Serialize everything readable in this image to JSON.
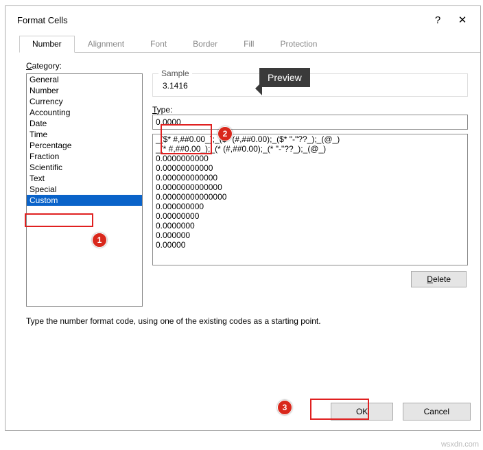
{
  "title": "Format Cells",
  "tabs": [
    "Number",
    "Alignment",
    "Font",
    "Border",
    "Fill",
    "Protection"
  ],
  "active_tab": 0,
  "category_label": "Category:",
  "categories": [
    "General",
    "Number",
    "Currency",
    "Accounting",
    "Date",
    "Time",
    "Percentage",
    "Fraction",
    "Scientific",
    "Text",
    "Special",
    "Custom"
  ],
  "selected_category_index": 11,
  "sample": {
    "legend": "Sample",
    "value": "3.1416"
  },
  "type_label": "Type:",
  "type_value": "0.0000",
  "format_codes": [
    "_($* #,##0.00_);_($* (#,##0.00);_($* \"-\"??_);_(@_)",
    "_(* #,##0.00_);_(* (#,##0.00);_(* \"-\"??_);_(@_)",
    "0.0000000000",
    "0.00000000000",
    "0.000000000000",
    "0.0000000000000",
    "0.00000000000000",
    "0.000000000",
    "0.00000000",
    "0.0000000",
    "0.000000",
    "0.00000"
  ],
  "delete_label": "Delete",
  "hint": "Type the number format code, using one of the existing codes as a starting point.",
  "ok_label": "OK",
  "cancel_label": "Cancel",
  "callout_preview": "Preview",
  "badges": [
    "1",
    "2",
    "3"
  ],
  "watermark": "wsxdn.com"
}
